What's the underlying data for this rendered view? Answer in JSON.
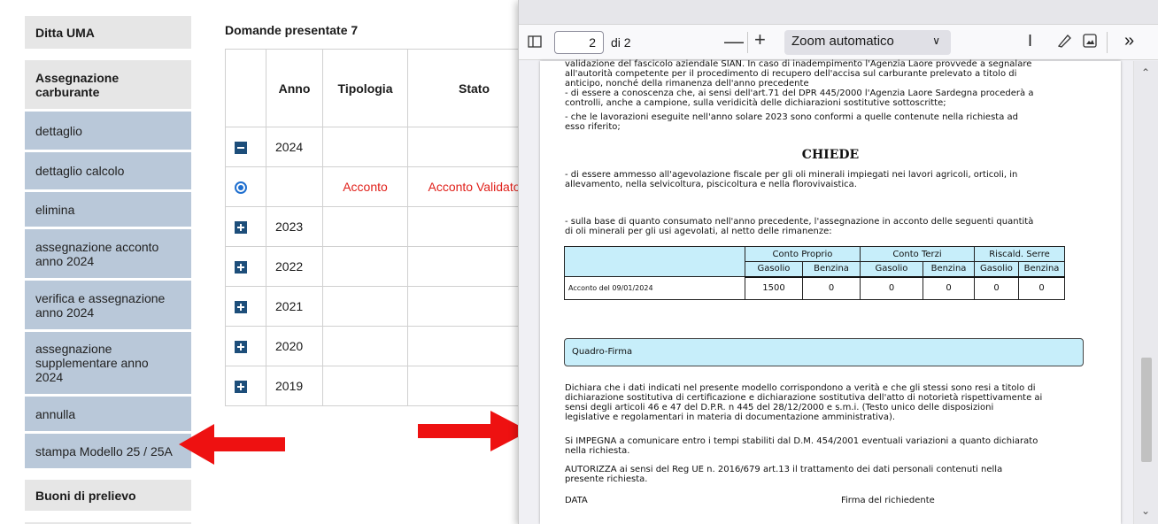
{
  "sidebar": {
    "items": [
      {
        "label": "Ditta UMA",
        "type": "head"
      },
      {
        "label": "Assegnazione carburante",
        "type": "head"
      },
      {
        "label": "dettaglio",
        "type": "item"
      },
      {
        "label": "dettaglio calcolo",
        "type": "item"
      },
      {
        "label": "elimina",
        "type": "item"
      },
      {
        "label": "assegnazione acconto anno 2024",
        "type": "item"
      },
      {
        "label": "verifica e assegnazione anno 2024",
        "type": "item"
      },
      {
        "label": "assegnazione supplementare anno 2024",
        "type": "item"
      },
      {
        "label": "annulla",
        "type": "item"
      },
      {
        "label": "stampa Modello 25 / 25A",
        "type": "item"
      },
      {
        "label": "Buoni di prelievo",
        "type": "head"
      }
    ]
  },
  "main": {
    "title": "Domande presentate 7",
    "columns": [
      "Anno",
      "Tipologia",
      "Stato"
    ],
    "rows": [
      {
        "icon": "collapse-icon",
        "anno": "2024",
        "tipologia": "",
        "stato": ""
      },
      {
        "icon": "radio-selected-icon",
        "anno": "",
        "tipologia": "Acconto",
        "stato": "Acconto Validato"
      },
      {
        "icon": "expand-icon",
        "anno": "2023",
        "tipologia": "",
        "stato": ""
      },
      {
        "icon": "expand-icon",
        "anno": "2022",
        "tipologia": "",
        "stato": ""
      },
      {
        "icon": "expand-icon",
        "anno": "2021",
        "tipologia": "",
        "stato": ""
      },
      {
        "icon": "expand-icon",
        "anno": "2020",
        "tipologia": "",
        "stato": ""
      },
      {
        "icon": "expand-icon",
        "anno": "2019",
        "tipologia": "",
        "stato": ""
      }
    ]
  },
  "viewer": {
    "page_number": "2",
    "of_pages": "di 2",
    "zoom_label": "Zoom automatico",
    "page": {
      "lines_top": [
        "validazione del fascicolo aziendale SIAN. In caso di inadempimento l'Agenzia Laore provvede a segnalare",
        "all'autorità competente per il procedimento di recupero dell'accisa sul carburante prelevato a titolo di",
        "anticipo, nonché della rimanenza dell'anno precedente",
        "- di essere a conoscenza che, ai sensi dell'art.71 del DPR 445/2000 l'Agenzia Laore Sardegna procederà a",
        "controlli, anche a campione, sulla veridicità delle dichiarazioni sostitutive sottoscritte;",
        "- che le lavorazioni eseguite nell'anno solare 2023 sono conformi a quelle contenute nella richiesta ad",
        "esso riferito;"
      ],
      "chiede": "CHIEDE",
      "lines_chiede": [
        "- di essere ammesso all'agevolazione fiscale per gli oli minerali impiegati nei lavori agricoli, orticoli, in",
        "allevamento, nella selvicoltura, piscicoltura e nella florovivaistica."
      ],
      "lines_base": [
        "- sulla base di quanto consumato nell'anno precedente, l'assegnazione in acconto delle seguenti quantità",
        "di oli minerali per gli usi agevolati, al netto delle rimanenze:"
      ],
      "table": {
        "groups": [
          "Conto Proprio",
          "Conto Terzi",
          "Riscald. Serre"
        ],
        "subheads": [
          "Gasolio",
          "Benzina",
          "Gasolio",
          "Benzina",
          "Gasolio",
          "Benzina"
        ],
        "row_label": "Acconto del 09/01/2024",
        "values": [
          "1500",
          "0",
          "0",
          "0",
          "0",
          "0"
        ]
      },
      "quadro_firma": "Quadro-Firma",
      "lines_dichiara": [
        "Dichiara che i dati indicati nel presente modello corrispondono a verità e che gli stessi sono resi a titolo di",
        "dichiarazione sostitutiva di certificazione e dichiarazione sostitutiva dell'atto di notorietà rispettivamente ai",
        "sensi degli articoli 46 e 47 del D.P.R. n 445 del 28/12/2000 e s.m.i. (Testo unico delle disposizioni",
        "legislative e regolamentari in materia di documentazione amministrativa)."
      ],
      "lines_impegna": [
        "Si IMPEGNA a comunicare entro i tempi stabiliti dal D.M. 454/2001 eventuali variazioni a quanto dichiarato",
        "nella richiesta."
      ],
      "lines_autorizza": [
        "AUTORIZZA ai sensi del Reg UE n. 2016/679 art.13 il trattamento dei dati personali contenuti nella",
        "presente richiesta."
      ],
      "data_label": "DATA",
      "firma_label": "Firma del richiedente"
    }
  },
  "colors": {
    "sidebar_head_bg": "#e6e6e6",
    "sidebar_item_bg": "#b9c8d9",
    "arrow_red": "#ee1111",
    "status_red": "#e0201a",
    "cyan_cells": "#c7eefa"
  }
}
